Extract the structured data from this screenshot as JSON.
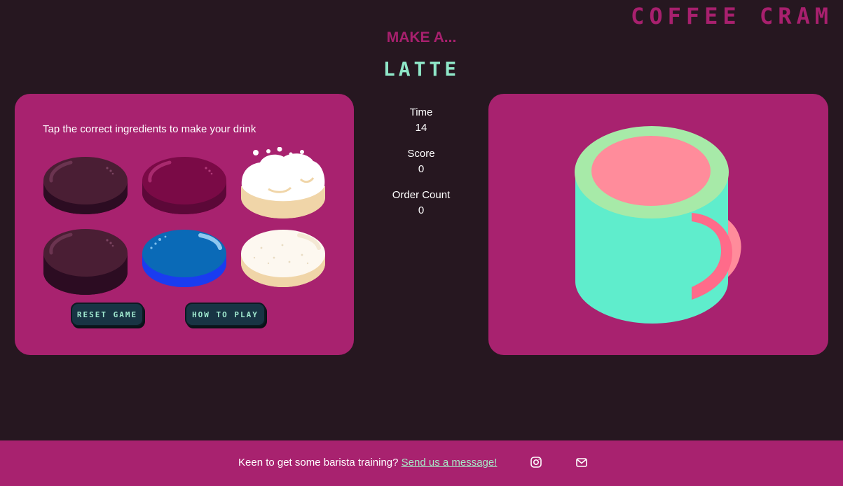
{
  "header": {
    "brand": "COFFEE CRAM",
    "make_label": "MAKE A...",
    "drink_name": "LATTE"
  },
  "game": {
    "instructions": "Tap the correct ingredients to make your drink",
    "ingredients": [
      {
        "icon": "dark-coffee-disc-icon",
        "color": "#4a1e34"
      },
      {
        "icon": "berry-syrup-disc-icon",
        "color": "#7a0a46"
      },
      {
        "icon": "whipped-cream-disc-icon",
        "color": "#ffffff"
      },
      {
        "icon": "dark-coffee-disc-icon",
        "color": "#4a1e34"
      },
      {
        "icon": "blue-syrup-disc-icon",
        "color": "#0a6ab7"
      },
      {
        "icon": "sugar-disc-icon",
        "color": "#fdf8f0"
      }
    ],
    "reset_label": "RESET GAME",
    "howto_label": "HOW TO PLAY"
  },
  "stats": {
    "time_label": "Time",
    "time_value": "14",
    "score_label": "Score",
    "score_value": "0",
    "order_label": "Order Count",
    "order_value": "0"
  },
  "cup": {
    "icon": "latte-mug-icon",
    "body_color": "#5fedcc",
    "rim_color": "#a7eaa8",
    "liquid_color": "#ff8c9b",
    "handle_color": "#ff6b8a"
  },
  "footer": {
    "text": "Keen to get some barista training?",
    "link": "Send us a message!",
    "icons": [
      "instagram-icon",
      "email-icon"
    ]
  },
  "colors": {
    "background": "#261720",
    "panel": "#a8226f",
    "accent_mint": "#8fe7c8"
  }
}
